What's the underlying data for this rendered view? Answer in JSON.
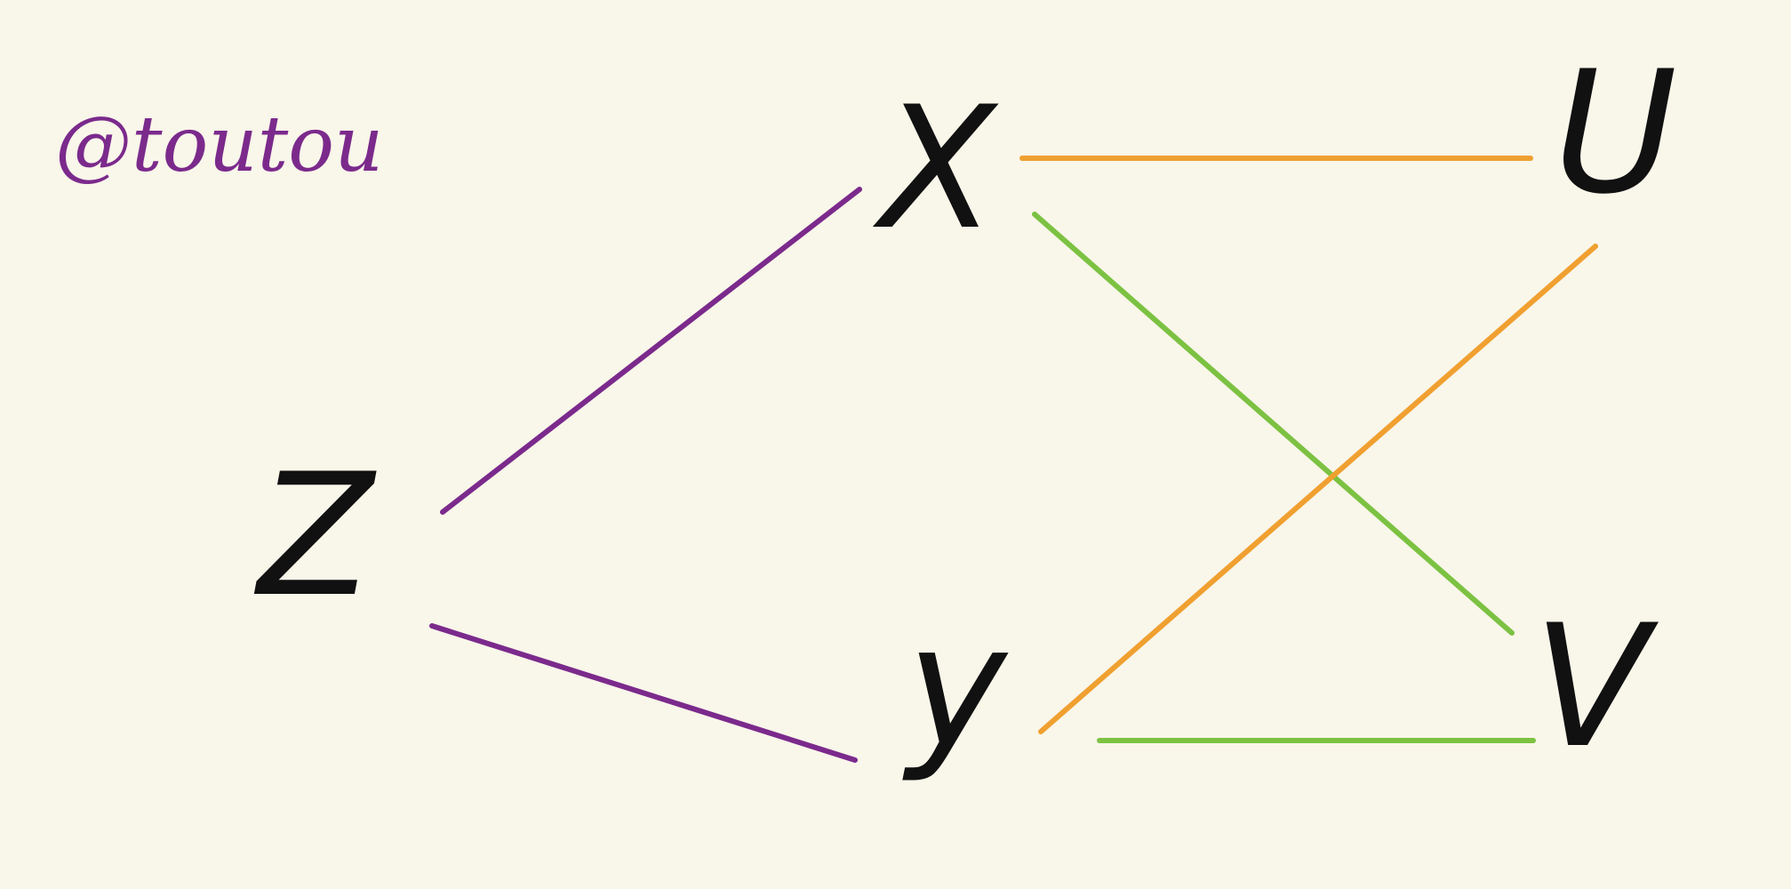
{
  "watermark": {
    "text": "@toutou",
    "color": "#7b2a8c"
  },
  "nodes": {
    "x": {
      "label": "X"
    },
    "u": {
      "label": "U"
    },
    "z": {
      "label": "Z"
    },
    "y": {
      "label": "y"
    },
    "v": {
      "label": "V"
    }
  },
  "edges": [
    {
      "id": "x-u",
      "from": "x",
      "to": "u",
      "color": "#f0a030"
    },
    {
      "id": "x-v",
      "from": "x",
      "to": "v",
      "color": "#7cc242"
    },
    {
      "id": "y-u",
      "from": "y",
      "to": "u",
      "color": "#f0a030"
    },
    {
      "id": "y-v",
      "from": "y",
      "to": "v",
      "color": "#7cc242"
    },
    {
      "id": "z-x",
      "from": "z",
      "to": "x",
      "color": "#7b2a8c"
    },
    {
      "id": "z-y",
      "from": "z",
      "to": "y",
      "color": "#7b2a8c"
    }
  ]
}
